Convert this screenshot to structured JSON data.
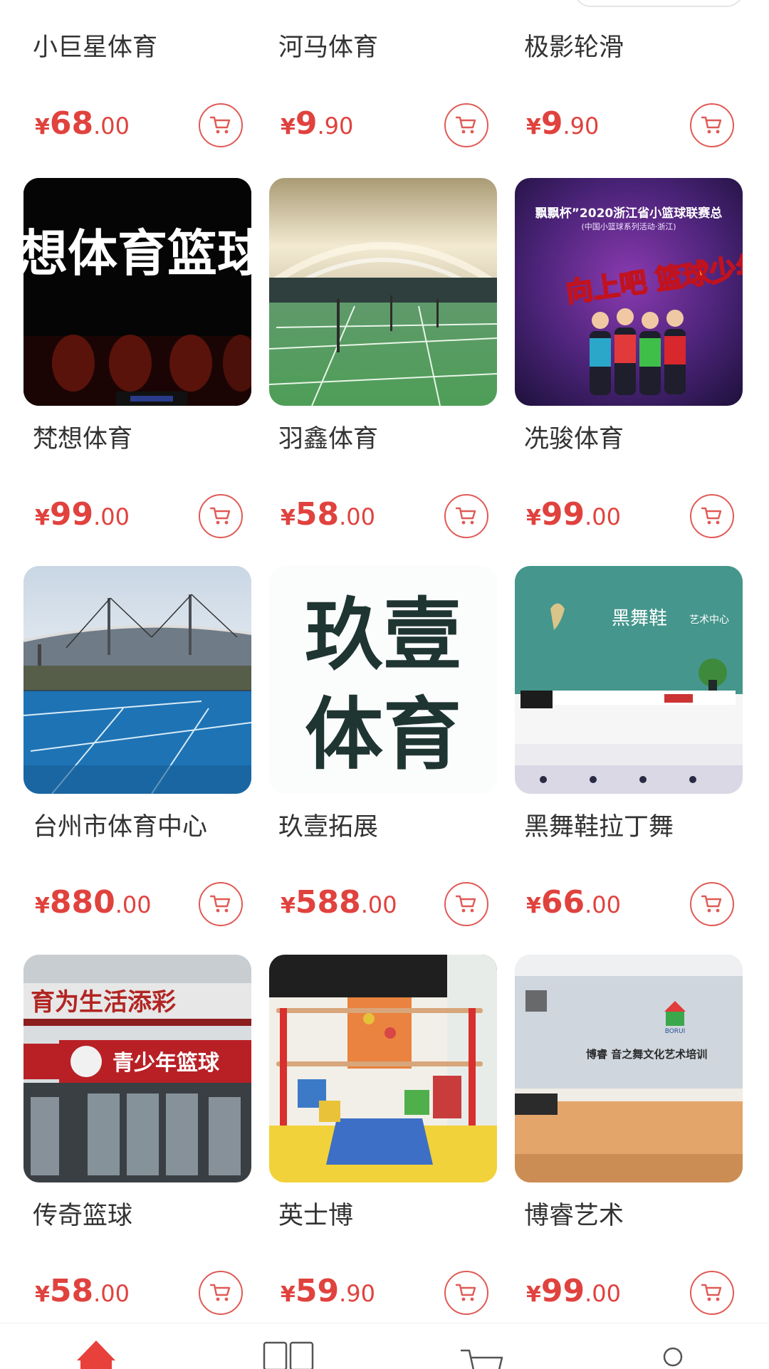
{
  "products": [
    {
      "name": "小巨星体育",
      "currency": "¥",
      "price_int": "68",
      "price_dec": ".00"
    },
    {
      "name": "河马体育",
      "currency": "¥",
      "price_int": "9",
      "price_dec": ".90"
    },
    {
      "name": "极影轮滑",
      "currency": "¥",
      "price_int": "9",
      "price_dec": ".90"
    },
    {
      "name": "梵想体育",
      "currency": "¥",
      "price_int": "99",
      "price_dec": ".00"
    },
    {
      "name": "羽鑫体育",
      "currency": "¥",
      "price_int": "58",
      "price_dec": ".00"
    },
    {
      "name": "冼骏体育",
      "currency": "¥",
      "price_int": "99",
      "price_dec": ".00"
    },
    {
      "name": "台州市体育中心",
      "currency": "¥",
      "price_int": "880",
      "price_dec": ".00"
    },
    {
      "name": "玖壹拓展",
      "currency": "¥",
      "price_int": "588",
      "price_dec": ".00"
    },
    {
      "name": "黑舞鞋拉丁舞",
      "currency": "¥",
      "price_int": "66",
      "price_dec": ".00"
    },
    {
      "name": "传奇篮球",
      "currency": "¥",
      "price_int": "58",
      "price_dec": ".00"
    },
    {
      "name": "英士博",
      "currency": "¥",
      "price_int": "59",
      "price_dec": ".90"
    },
    {
      "name": "博睿艺术",
      "currency": "¥",
      "price_int": "99",
      "price_dec": ".00"
    }
  ],
  "image_text": {
    "fanxiang": "想体育篮球中",
    "xianjun_banner": "飘飘杯”2020浙江省小篮球联赛总",
    "xianjun_sub": "(中国小篮球系列活动·浙江)",
    "xianjun_title": "向上吧 篮球少年",
    "jiuyi_line1": "玖壹",
    "jiuyi_line2": "体育",
    "heiwuxie_logo": "黑舞鞋",
    "heiwuxie_sub": "艺术中心",
    "chuanqi_top": "育为生活添彩",
    "chuanqi_banner": "青少年篮球",
    "borui_logo": "BORUI",
    "borui_wall": "博睿 音之舞文化艺术培训"
  },
  "colors": {
    "accent": "#e0423e",
    "nav_active": "#e8413b",
    "nav_inactive": "#555555"
  },
  "bottom_nav": [
    {
      "icon": "home-icon",
      "active": true
    },
    {
      "icon": "category-icon",
      "active": false
    },
    {
      "icon": "cart-icon",
      "active": false
    },
    {
      "icon": "user-icon",
      "active": false
    }
  ]
}
